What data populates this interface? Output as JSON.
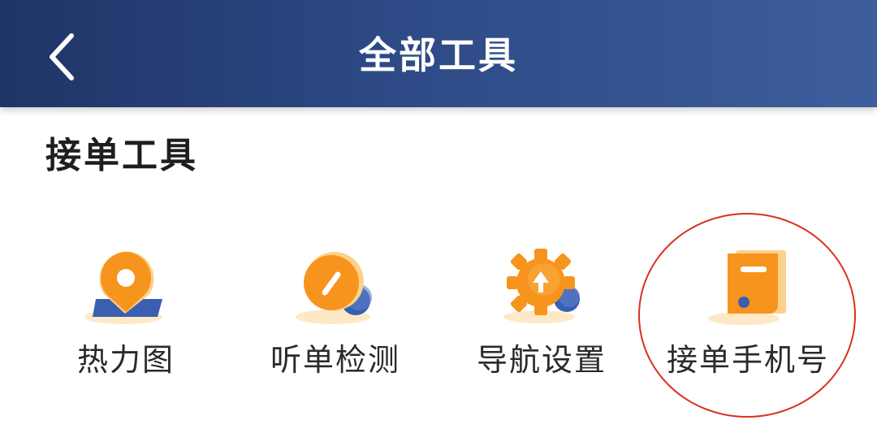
{
  "header": {
    "title": "全部工具",
    "back_icon": "chevron-left-icon"
  },
  "section": {
    "title": "接单工具"
  },
  "tools": [
    {
      "label": "热力图",
      "icon": "heatmap-location-icon"
    },
    {
      "label": "听单检测",
      "icon": "gauge-icon"
    },
    {
      "label": "导航设置",
      "icon": "gear-arrow-icon"
    },
    {
      "label": "接单手机号",
      "icon": "phone-card-icon"
    }
  ],
  "colors": {
    "header_start": "#1f3466",
    "header_end": "#3d5d9c",
    "accent_orange": "#f7941d",
    "accent_blue": "#3a5fb0",
    "highlight_red": "#d8321f"
  }
}
